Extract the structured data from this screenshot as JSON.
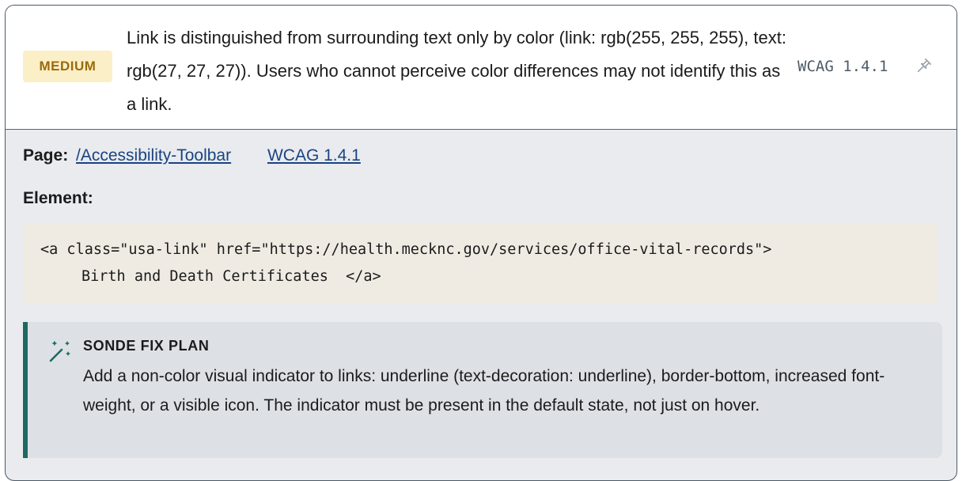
{
  "issue": {
    "severity": "MEDIUM",
    "summary": "Link is distinguished from surrounding text only by color (link: rgb(255, 255, 255), text: rgb(27, 27, 27)). Users who cannot perceive color differences may not identify this as a link.",
    "wcag_tag": "WCAG 1.4.1"
  },
  "details": {
    "page_label": "Page:",
    "page_link": "/Accessibility-Toolbar",
    "wcag_link": "WCAG 1.4.1",
    "element_label": "Element:",
    "code_line1": "<a class=\"usa-link\" href=\"https://health.mecknc.gov/services/office-vital-records\">",
    "code_line2": "Birth and Death Certificates  </a>"
  },
  "fix_plan": {
    "title": "SONDE FIX PLAN",
    "text": "Add a non-color visual indicator to links: underline (text-decoration: underline), border-bottom, increased font-weight, or a visible icon. The indicator must be present in the default state, not just on hover."
  },
  "icons": {
    "pin": "pin-icon",
    "external": "external-link-icon",
    "wand": "magic-wand-icon"
  },
  "colors": {
    "badge_bg": "#fbefc7",
    "badge_text": "#9a6b0a",
    "link": "#1a4480",
    "fix_accent": "#1e6a62",
    "code_bg": "#efebe3"
  }
}
